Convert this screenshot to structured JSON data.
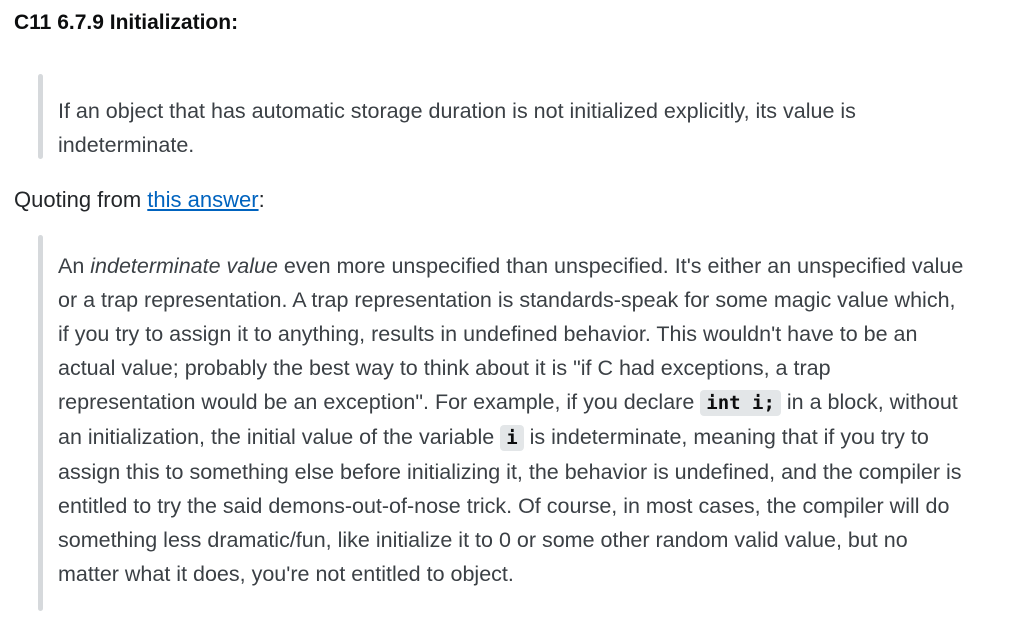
{
  "heading": "C11 6.7.9 Initialization:",
  "quote1": {
    "text": "If an object that has automatic storage duration is not initialized explicitly, its value is indeterminate."
  },
  "quoting": {
    "prefix": "Quoting from ",
    "link_text": "this answer",
    "suffix": ":"
  },
  "quote2": {
    "part1": "An ",
    "em1": "indeterminate value",
    "part2": " even more unspecified than unspecified. It's either an unspecified value or a trap representation. A trap representation is standards-speak for some magic value which, if you try to assign it to anything, results in undefined behavior. This wouldn't have to be an actual value; probably the best way to think about it is \"if C had exceptions, a trap representation would be an exception\". For example, if you declare ",
    "code1": "int i;",
    "part3": " in a block, without an initialization, the initial value of the variable ",
    "code2": "i",
    "part4": " is indeterminate, meaning that if you try to assign this to something else before initializing it, the behavior is undefined, and the compiler is entitled to try the said demons-out-of-nose trick. Of course, in most cases, the compiler will do something less dramatic/fun, like initialize it to 0 or some other random valid value, but no matter what it does, you're not entitled to object."
  }
}
